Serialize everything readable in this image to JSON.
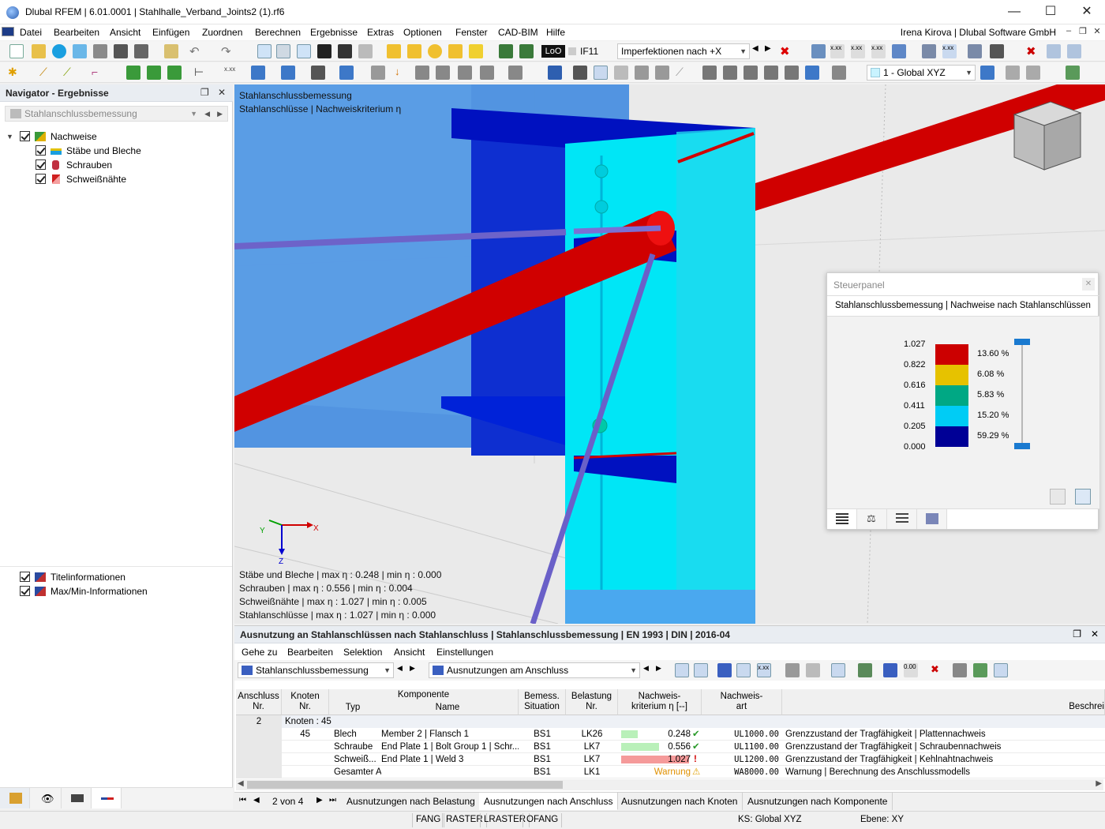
{
  "window": {
    "title": "Dlubal RFEM | 6.01.0001 | Stahlhalle_Verband_Joints2 (1).rf6",
    "min_icon": "minimize-icon",
    "max_icon": "maximize-icon",
    "close_icon": "close-icon"
  },
  "menu": {
    "items": [
      "Datei",
      "Bearbeiten",
      "Ansicht",
      "Einfügen",
      "Zuordnen",
      "Berechnen",
      "Ergebnisse",
      "Extras",
      "Optionen",
      "Fenster",
      "CAD-BIM",
      "Hilfe"
    ],
    "user": "Irena Kirova | Dlubal Software GmbH"
  },
  "toolbar": {
    "loo_label": "LoO",
    "if_label": "IF11",
    "imperfection_combo": "Imperfektionen nach +X",
    "cs_combo": "1 - Global XYZ"
  },
  "navigator": {
    "title": "Navigator - Ergebnisse",
    "combo": "Stahlanschlussbemessung",
    "tree": {
      "root": "Nachweise",
      "children": [
        "Stäbe und Bleche",
        "Schrauben",
        "Schweißnähte"
      ]
    },
    "bottom_items": [
      "Titelinformationen",
      "Max/Min-Informationen"
    ]
  },
  "viewport": {
    "title_line1": "Stahlanschlussbemessung",
    "title_line2": "Stahlanschlüsse | Nachweiskriterium η",
    "axis_x": "X",
    "axis_y": "Y",
    "axis_z": "Z",
    "maxmin": [
      "Stäbe und Bleche | max η : 0.248 | min η : 0.000",
      "Schrauben | max η : 0.556 | min η : 0.004",
      "Schweißnähte | max η : 1.027 | min η : 0.005",
      "Stahlanschlüsse | max η : 1.027 | min η : 0.000"
    ]
  },
  "control_panel": {
    "title": "Steuerpanel",
    "subtitle": "Stahlanschlussbemessung | Nachweise nach Stahlanschlüssen",
    "legend": [
      {
        "value": "1.027",
        "percent": "13.60 %",
        "color": "#cc0000"
      },
      {
        "value": "0.822",
        "percent": "6.08 %",
        "color": "#e6c200"
      },
      {
        "value": "0.616",
        "percent": "5.83 %",
        "color": "#00a884"
      },
      {
        "value": "0.411",
        "percent": "15.20 %",
        "color": "#00ccf5"
      },
      {
        "value": "0.205",
        "percent": "59.29 %",
        "color": "#000096"
      }
    ],
    "legend_min": "0.000"
  },
  "results": {
    "title": "Ausnutzung an Stahlanschlüssen nach Stahlanschluss | Stahlanschlussbemessung | EN 1993 | DIN | 2016-04",
    "menu": [
      "Gehe zu",
      "Bearbeiten",
      "Selektion",
      "Ansicht",
      "Einstellungen"
    ],
    "combo1": "Stahlanschlussbemessung",
    "combo2": "Ausnutzungen am Anschluss",
    "headers": {
      "anschluss": [
        "Anschluss",
        "Nr."
      ],
      "knoten": [
        "Knoten",
        "Nr."
      ],
      "komponente": "Komponente",
      "typ": "Typ",
      "name": "Name",
      "bemess": [
        "Bemess.",
        "Situation"
      ],
      "belastung": [
        "Belastung",
        "Nr."
      ],
      "kriterium": [
        "Nachweis-",
        "kriterium η [--]"
      ],
      "art": [
        "Nachweis-",
        "art"
      ],
      "beschr": "Beschrei"
    },
    "group_anschluss": "2",
    "group_label": "Knoten : 45",
    "knoten_nr": "45",
    "rows": [
      {
        "typ": "Blech",
        "name": "Member 2 | Flansch 1",
        "situation": "BS1",
        "lk": "LK26",
        "eta": "0.248",
        "eta_num": 0.248,
        "status": "ok",
        "art": "UL1000.00",
        "desc": "Grenzzustand der Tragfähigkeit | Plattennachweis"
      },
      {
        "typ": "Schraube",
        "name": "End Plate 1 | Bolt Group 1 | Schr...",
        "situation": "BS1",
        "lk": "LK7",
        "eta": "0.556",
        "eta_num": 0.556,
        "status": "ok",
        "art": "UL1100.00",
        "desc": "Grenzzustand der Tragfähigkeit | Schraubennachweis"
      },
      {
        "typ": "Schweiß...",
        "name": "End Plate 1 | Weld 3",
        "situation": "BS1",
        "lk": "LK7",
        "eta": "1.027",
        "eta_num": 1.027,
        "status": "fail",
        "art": "UL1200.00",
        "desc": "Grenzzustand der Tragfähigkeit | Kehlnahtnachweis"
      },
      {
        "typ": "Gesamter Anschluss",
        "name": "",
        "situation": "BS1",
        "lk": "LK1",
        "eta": "Warnung",
        "eta_num": 0,
        "status": "warn",
        "art": "WA8000.00",
        "desc": "Warnung | Berechnung des Anschlussmodells"
      }
    ],
    "pager": "2 von 4",
    "tabs": [
      "Ausnutzungen nach Belastung",
      "Ausnutzungen nach Anschluss",
      "Ausnutzungen nach Knoten",
      "Ausnutzungen nach Komponente"
    ],
    "active_tab": 1
  },
  "status": {
    "buttons": [
      "FANG",
      "RASTER",
      "LRASTER",
      "OFANG"
    ],
    "ks": "KS: Global XYZ",
    "ebene": "Ebene: XY"
  }
}
